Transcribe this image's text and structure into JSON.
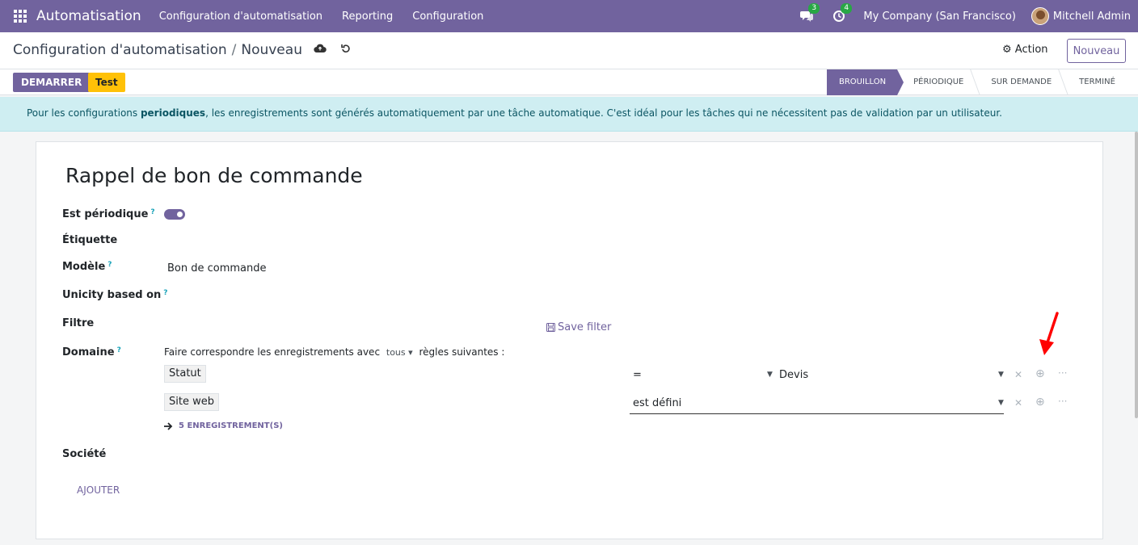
{
  "navbar": {
    "app_name": "Automatisation",
    "menu": [
      "Configuration d'automatisation",
      "Reporting",
      "Configuration"
    ],
    "messages_count": "3",
    "activities_count": "4",
    "company": "My Company (San Francisco)",
    "user": "Mitchell Admin"
  },
  "breadcrumb": {
    "parent": "Configuration d'automatisation",
    "current": "Nouveau"
  },
  "control": {
    "action_label": "Action",
    "new_label": "Nouveau"
  },
  "buttons": {
    "start": "DEMARRER",
    "test": "Test"
  },
  "stages": [
    "BROUILLON",
    "PÉRIODIQUE",
    "SUR DEMANDE",
    "TERMINÉ"
  ],
  "alert": {
    "prefix": "Pour les configurations ",
    "bold": "periodiques",
    "suffix": ", les enregistrements sont générés automatiquement par une tâche automatique. C'est idéal pour les tâches qui ne nécessitent pas de validation par un utilisateur."
  },
  "form": {
    "title": "Rappel de bon de commande",
    "labels": {
      "periodic": "Est périodique",
      "label": "Étiquette",
      "model": "Modèle",
      "unicity": "Unicity based on",
      "filter": "Filtre",
      "domain": "Domaine",
      "company": "Société"
    },
    "help_mark": "?",
    "model_value": "Bon de commande",
    "save_filter": "Save filter",
    "domain_desc_prefix": "Faire correspondre les enregistrements avec",
    "domain_mode": "tous",
    "domain_desc_suffix": "règles suivantes :",
    "rules": [
      {
        "field": "Statut",
        "operator": "=",
        "value": "Devis"
      },
      {
        "field": "Site web",
        "operator": "est défini",
        "value": ""
      }
    ],
    "records_link": "5 ENREGISTREMENT(S)",
    "add_link": "AJOUTER"
  }
}
